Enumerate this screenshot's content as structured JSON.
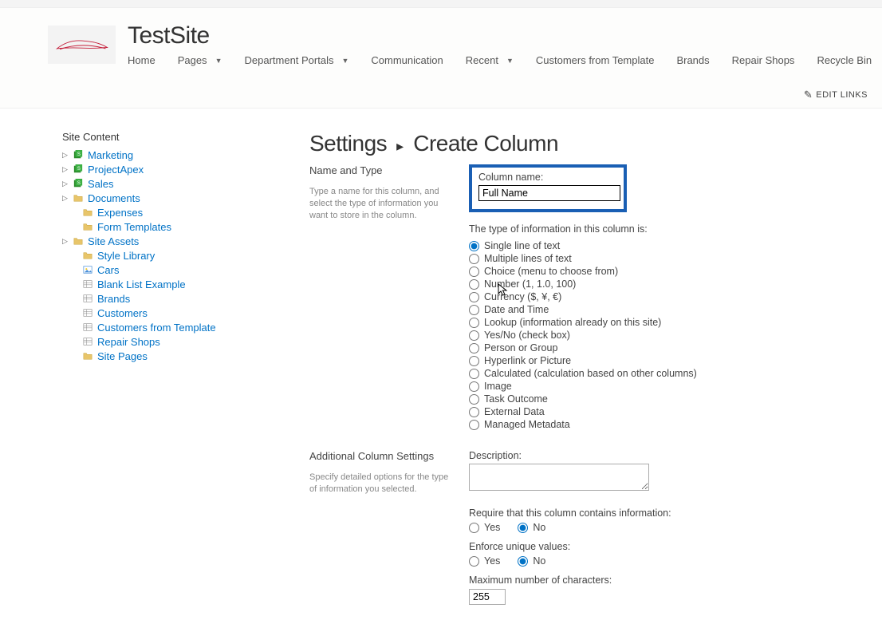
{
  "site": {
    "title": "TestSite"
  },
  "nav": {
    "items": [
      {
        "label": "Home",
        "hasDropdown": false
      },
      {
        "label": "Pages",
        "hasDropdown": true
      },
      {
        "label": "Department Portals",
        "hasDropdown": true
      },
      {
        "label": "Communication",
        "hasDropdown": false
      },
      {
        "label": "Recent",
        "hasDropdown": true
      },
      {
        "label": "Customers from Template",
        "hasDropdown": false
      },
      {
        "label": "Brands",
        "hasDropdown": false
      },
      {
        "label": "Repair Shops",
        "hasDropdown": false
      },
      {
        "label": "Recycle Bin",
        "hasDropdown": false
      }
    ],
    "editLinks": "EDIT LINKS"
  },
  "sidebar": {
    "heading": "Site Content",
    "items": [
      {
        "label": "Marketing",
        "level": 0,
        "icon": "sp-green",
        "expander": true
      },
      {
        "label": "ProjectApex",
        "level": 0,
        "icon": "sp-green",
        "expander": true
      },
      {
        "label": "Sales",
        "level": 0,
        "icon": "sp-green",
        "expander": true
      },
      {
        "label": "Documents",
        "level": 0,
        "icon": "folder",
        "expander": true
      },
      {
        "label": "Expenses",
        "level": 1,
        "icon": "folder",
        "expander": false
      },
      {
        "label": "Form Templates",
        "level": 1,
        "icon": "folder",
        "expander": false
      },
      {
        "label": "Site Assets",
        "level": 0,
        "icon": "folder",
        "expander": true
      },
      {
        "label": "Style Library",
        "level": 1,
        "icon": "folder",
        "expander": false
      },
      {
        "label": "Cars",
        "level": 1,
        "icon": "image",
        "expander": false
      },
      {
        "label": "Blank List Example",
        "level": 1,
        "icon": "list",
        "expander": false
      },
      {
        "label": "Brands",
        "level": 1,
        "icon": "list",
        "expander": false
      },
      {
        "label": "Customers",
        "level": 1,
        "icon": "list",
        "expander": false
      },
      {
        "label": "Customers from Template",
        "level": 1,
        "icon": "list",
        "expander": false
      },
      {
        "label": "Repair Shops",
        "level": 1,
        "icon": "list",
        "expander": false
      },
      {
        "label": "Site Pages",
        "level": 1,
        "icon": "folder",
        "expander": false
      }
    ]
  },
  "page": {
    "titleA": "Settings",
    "titleSep": "▸",
    "titleB": "Create Column"
  },
  "section1": {
    "heading": "Name and Type",
    "desc": "Type a name for this column, and select the type of information you want to store in the column.",
    "columnNameLabel": "Column name:",
    "columnNameValue": "Full Name",
    "typeIntro": "The type of information in this column is:",
    "types": [
      "Single line of text",
      "Multiple lines of text",
      "Choice (menu to choose from)",
      "Number (1, 1.0, 100)",
      "Currency ($, ¥, €)",
      "Date and Time",
      "Lookup (information already on this site)",
      "Yes/No (check box)",
      "Person or Group",
      "Hyperlink or Picture",
      "Calculated (calculation based on other columns)",
      "Image",
      "Task Outcome",
      "External Data",
      "Managed Metadata"
    ],
    "selectedTypeIndex": 0
  },
  "section2": {
    "heading": "Additional Column Settings",
    "desc": "Specify detailed options for the type of information you selected.",
    "descriptionLabel": "Description:",
    "descriptionValue": "",
    "requireLabel": "Require that this column contains information:",
    "requireYes": "Yes",
    "requireNo": "No",
    "requireValue": "No",
    "uniqueLabel": "Enforce unique values:",
    "uniqueYes": "Yes",
    "uniqueNo": "No",
    "uniqueValue": "No",
    "maxCharsLabel": "Maximum number of characters:",
    "maxCharsValue": "255"
  }
}
